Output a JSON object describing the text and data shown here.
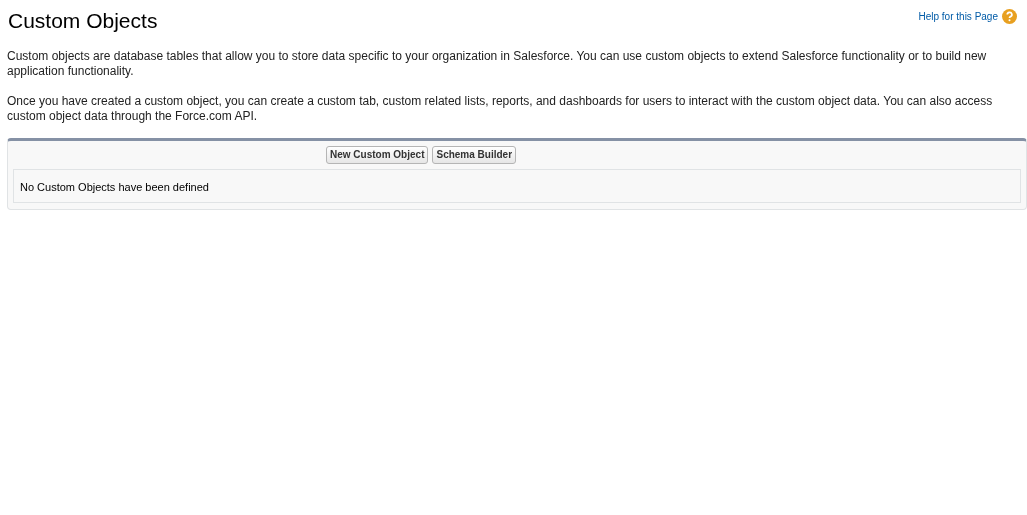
{
  "title": "Custom Objects",
  "help_link": "Help for this Page",
  "paragraphs": [
    "Custom objects are database tables that allow you to store data specific to your organization in Salesforce. You can use custom objects to extend Salesforce functionality or to build new application functionality.",
    "Once you have created a custom object, you can create a custom tab, custom related lists, reports, and dashboards for users to interact with the custom object data. You can also access custom object data through the Force.com API."
  ],
  "buttons": [
    "New Custom Object",
    "Schema Builder"
  ],
  "empty_message": "No Custom Objects have been defined"
}
